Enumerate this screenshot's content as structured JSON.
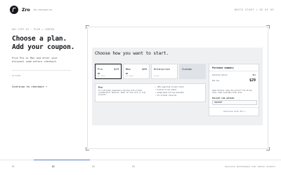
{
  "header": {
    "brand": "Zro",
    "by": "by conquer.co",
    "right": "QUICK START / 02 OF 05"
  },
  "left": {
    "breadcrumb": "DOC STEP 02 · PLAN + COUPON",
    "headline_line1": "Choose a plan.",
    "headline_line2": "Add your coupon.",
    "subtext": "Pick Pro or Max and enter your discount code before checkout.",
    "action_label": "ACTION",
    "continue": "Continue to checkout →"
  },
  "app": {
    "title": "Choose how you want to start.",
    "plans": [
      {
        "name": "Pro",
        "price": "$29",
        "sub": "$0",
        "sub2": "per month"
      },
      {
        "name": "Max",
        "price": "$69",
        "sub": "$0",
        "sub2": "per month"
      },
      {
        "name": "Enterprise",
        "price": "",
        "sub": "",
        "sub2": "custom"
      },
      {
        "name": "Custom",
        "price": "",
        "sub": "",
        "sub2": ""
      }
    ],
    "detail": {
      "name": "Pro",
      "description": "For individual developers starting with private collaboration features. Ideal for solo work or side projects.",
      "features": [
        "• 100% supported private limits",
        "• Premium AI and models",
        "• Usage-based billing available",
        "• Git-tracked libraries"
      ]
    },
    "summary": {
      "title": "Purchase summary",
      "row1_label": "Selected option",
      "row1_value": "Pro",
      "row2_label": "Due now",
      "row2_value": "$29",
      "note": "Subscriptions renew the account from Stripe until reset available after plan.",
      "code_label": "Discount code optional",
      "code_value": "SNAPSHOT",
      "cta": "Continue with Pro →"
    }
  },
  "timeline": {
    "labels": [
      "01",
      "02",
      "03",
      "04"
    ],
    "active_index": 1,
    "progress": 0.2,
    "right": "PRIVATE REFERENCE FOR ENTRY POINTS"
  }
}
